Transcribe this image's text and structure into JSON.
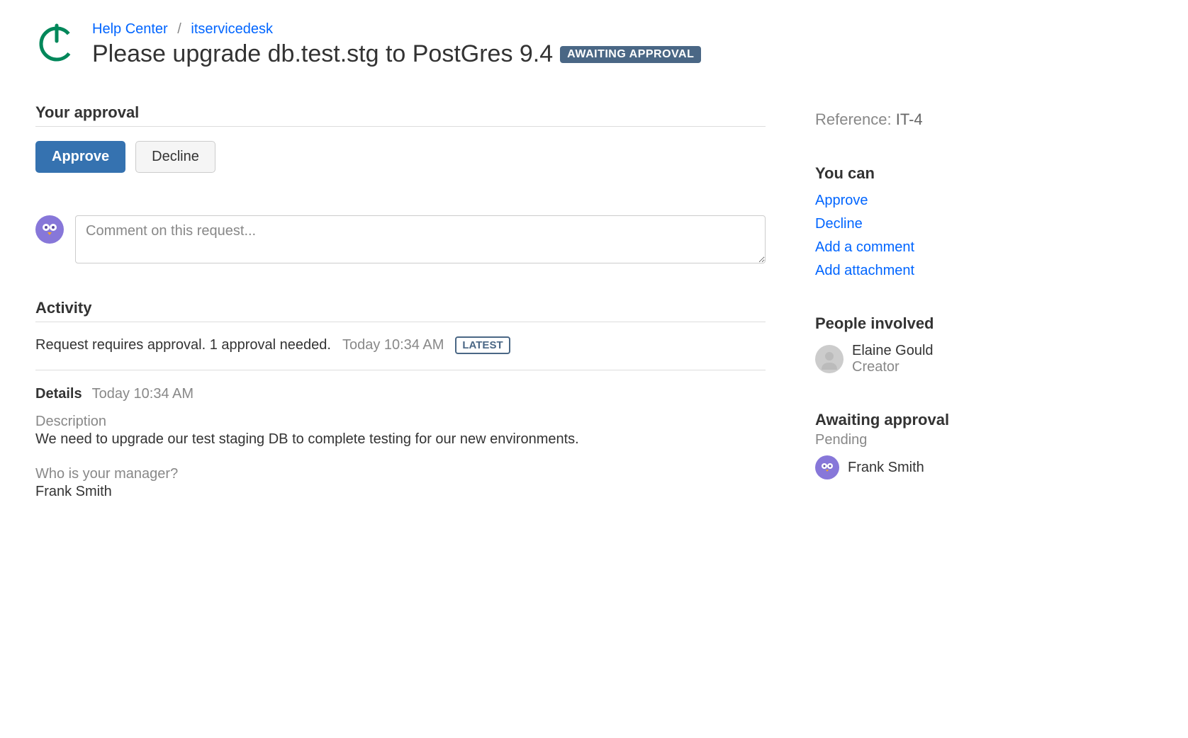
{
  "breadcrumb": {
    "help_center": "Help Center",
    "project": "itservicedesk"
  },
  "page": {
    "title": "Please upgrade db.test.stg to PostGres 9.4",
    "status": "AWAITING APPROVAL"
  },
  "approval": {
    "section_title": "Your approval",
    "approve_label": "Approve",
    "decline_label": "Decline"
  },
  "comment": {
    "placeholder": "Comment on this request..."
  },
  "activity": {
    "section_title": "Activity",
    "items": [
      {
        "text": "Request requires approval. 1 approval needed.",
        "time": "Today 10:34 AM",
        "latest": "LATEST"
      }
    ]
  },
  "details": {
    "title": "Details",
    "time": "Today 10:34 AM",
    "fields": [
      {
        "label": "Description",
        "value": "We need to upgrade our test staging DB to complete testing for our new environments."
      },
      {
        "label": "Who is your manager?",
        "value": "Frank Smith"
      }
    ]
  },
  "reference": {
    "label": "Reference:",
    "value": "IT-4"
  },
  "you_can": {
    "title": "You can",
    "actions": [
      {
        "label": "Approve"
      },
      {
        "label": "Decline"
      },
      {
        "label": "Add a comment"
      },
      {
        "label": "Add attachment"
      }
    ]
  },
  "people": {
    "title": "People involved",
    "items": [
      {
        "name": "Elaine Gould",
        "role": "Creator"
      }
    ]
  },
  "awaiting": {
    "title": "Awaiting approval",
    "status": "Pending",
    "items": [
      {
        "name": "Frank Smith"
      }
    ]
  }
}
